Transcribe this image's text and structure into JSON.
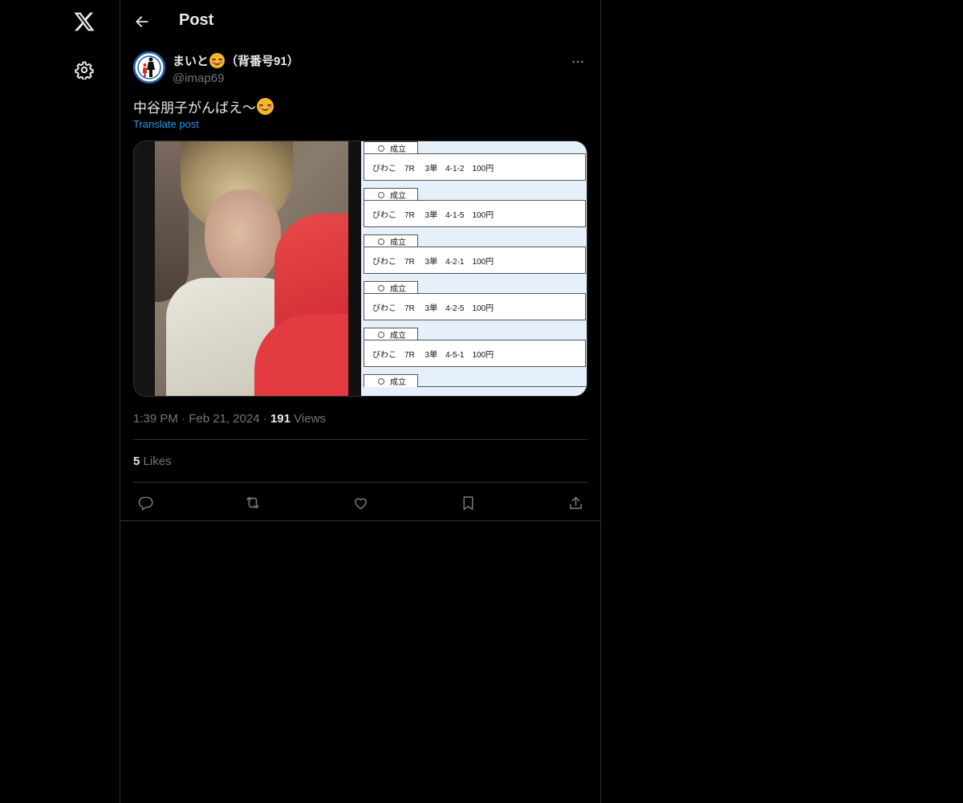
{
  "nav": {
    "logo_icon": "x-logo-icon",
    "settings_icon": "gear-icon"
  },
  "header": {
    "back_icon": "arrow-left-icon",
    "title": "Post"
  },
  "post": {
    "author": {
      "name_before": "まいと",
      "name_emoji": "smiling-face-emoji",
      "name_after": "（背番号91）",
      "handle": "@imap69",
      "avatar": "avatar-logo"
    },
    "more_icon": "more-icon",
    "text": "中谷朋子がんばえ〜",
    "text_emoji": "smiling-face-emoji",
    "translate_label": "Translate post",
    "media": {
      "tickets": [
        {
          "status": "成立",
          "detail": "びわこ　7R　 3単　4-1-2　100円"
        },
        {
          "status": "成立",
          "detail": "びわこ　7R　 3単　4-1-5　100円"
        },
        {
          "status": "成立",
          "detail": "びわこ　7R　 3単　4-2-1　100円"
        },
        {
          "status": "成立",
          "detail": "びわこ　7R　 3単　4-2-5　100円"
        },
        {
          "status": "成立",
          "detail": "びわこ　7R　 3単　4-5-1　100円"
        },
        {
          "status": "成立",
          "detail": ""
        }
      ]
    },
    "time": "1:39 PM",
    "date": "Feb 21, 2024",
    "separator": "·",
    "views_count": "191",
    "views_label": "Views",
    "likes_count": "5",
    "likes_label": "Likes",
    "actions": [
      "reply-icon",
      "repost-icon",
      "like-icon",
      "bookmark-icon",
      "share-icon"
    ]
  },
  "colors": {
    "background": "#000000",
    "text": "#e7e9ea",
    "muted": "#71767b",
    "accent": "#1d9bf0",
    "border": "#2f3336"
  }
}
